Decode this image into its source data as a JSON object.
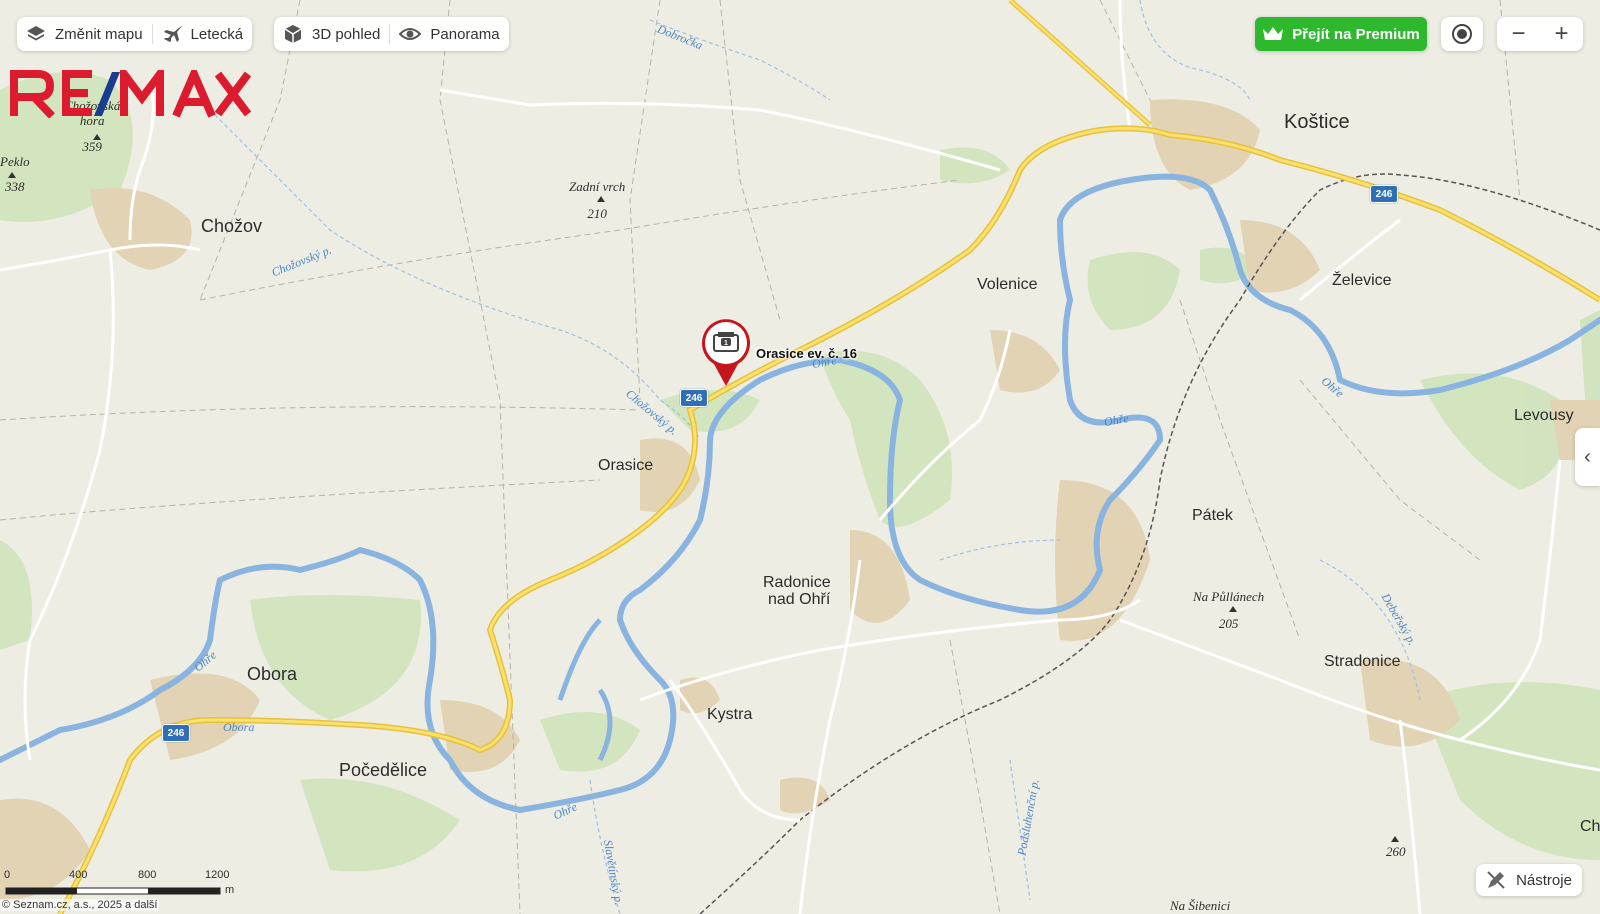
{
  "toolbar": {
    "change_map": "Změnit mapu",
    "aerial": "Letecká",
    "view_3d": "3D pohled",
    "panorama": "Panorama"
  },
  "premium_label": "Přejít na Premium",
  "zoom": {
    "out": "−",
    "in": "+"
  },
  "side_toggle": "‹",
  "tools_label": "Nástroje",
  "logo_text": "RE/MAX",
  "marker": {
    "label": "Orasice ev. č. 16",
    "icon": "property-pin-icon",
    "badge": "1"
  },
  "places": {
    "kostice": "Koštice",
    "chozov": "Chožov",
    "volenice": "Volenice",
    "zelevice": "Želevice",
    "orasice": "Orasice",
    "levousy": "Levousy",
    "patek": "Pátek",
    "radonice1": "Radonice",
    "radonice2": "nad Ohří",
    "obora": "Obora",
    "pocedelice": "Počedělice",
    "kystra": "Kystra",
    "stradonice": "Stradonice",
    "ch": "Ch"
  },
  "peaks": {
    "chozovska1": "Chožovská",
    "chozovska2": "hora",
    "chozovska_h": "359",
    "peklo": "Peklo",
    "peklo_h": "338",
    "zadni": "Zadní vrch",
    "zadni_h": "210",
    "pullanech": "Na Půllánech",
    "pullanech_h": "205",
    "h260": "260",
    "sibenici": "Na Šibenici"
  },
  "water": {
    "dobrocka": "Dobročka",
    "chozovsky1": "Chožovský p.",
    "chozovsky2": "Chožovský p.",
    "ohre1": "Ohře",
    "ohre2": "Ohře",
    "ohre3": "Ohře",
    "ohre4": "Ohře",
    "ohre5": "Ohře",
    "obora_w": "Obora",
    "debersky": "Debeřský p.",
    "slavetinsky": "Slavětínský p.",
    "podsheltemi": "Podsluhenční p."
  },
  "road_number": "246",
  "scale": {
    "labels": [
      "0",
      "400",
      "800",
      "1200"
    ],
    "unit": "m"
  },
  "copyright": {
    "text": "© Seznam.cz, a.s., 2025 a ",
    "link": "další"
  },
  "colors": {
    "premium": "#2eb82e",
    "river": "#8ab4e0",
    "road": "#f5d53f",
    "remax_red": "#dc1c2e",
    "remax_blue": "#1a3d8f",
    "pin": "#c4161c"
  }
}
